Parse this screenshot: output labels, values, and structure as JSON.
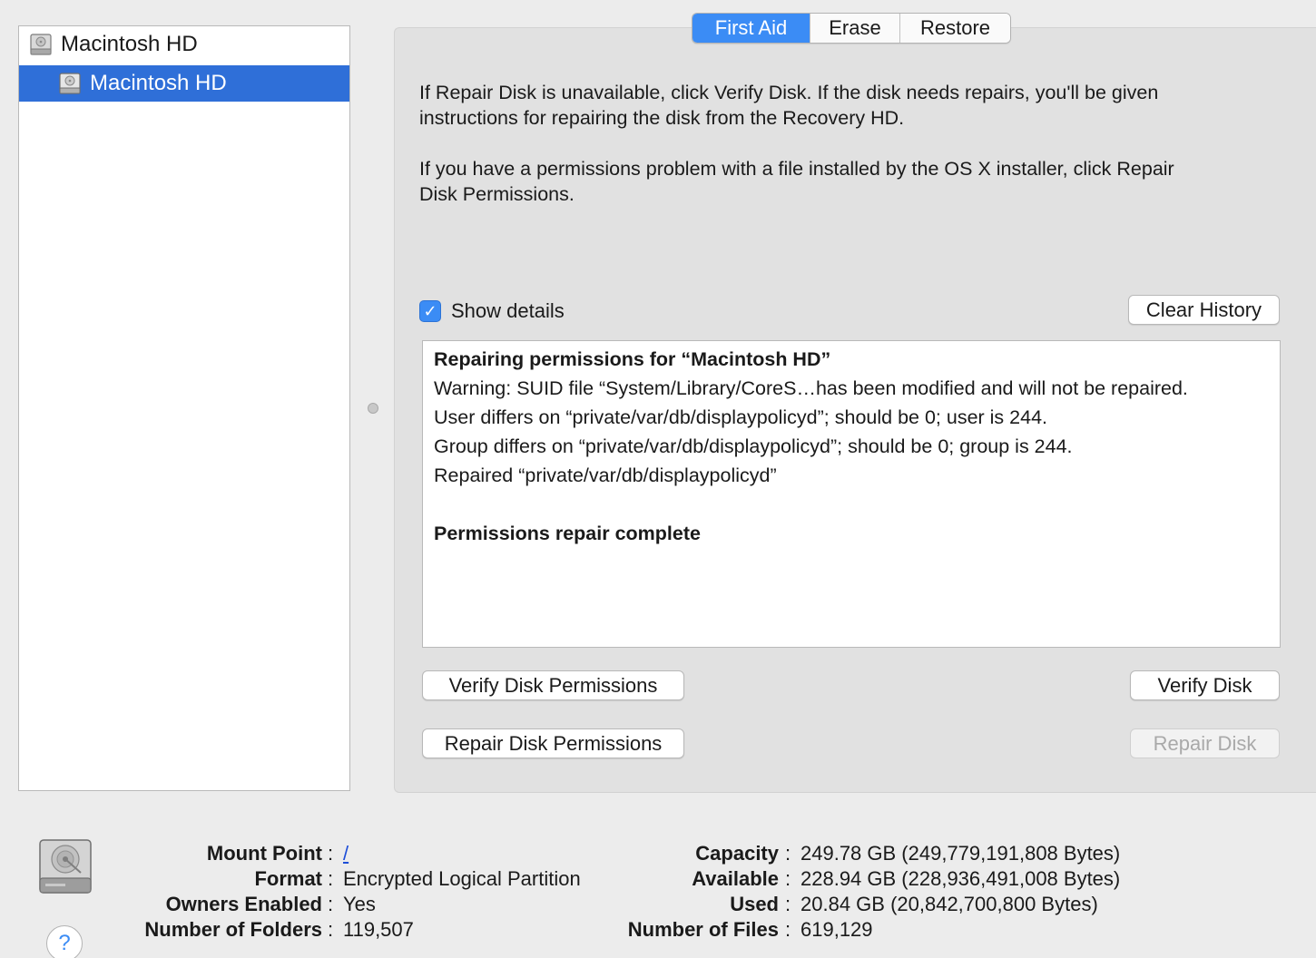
{
  "sidebar": {
    "items": [
      {
        "label": "Macintosh HD"
      },
      {
        "label": "Macintosh HD"
      }
    ]
  },
  "tabs": [
    {
      "label": "First Aid",
      "active": true
    },
    {
      "label": "Erase"
    },
    {
      "label": "Restore"
    }
  ],
  "first_aid": {
    "desc1_line1": "If Repair Disk is unavailable, click Verify Disk. If the disk needs repairs, you'll be given",
    "desc1_line2": "instructions for repairing the disk from the Recovery HD.",
    "desc2_line1": "If you have a permissions problem with a file installed by the OS X installer, click Repair",
    "desc2_line2": "Disk Permissions.",
    "show_details_label": "Show details",
    "show_details_checked": true,
    "clear_history_label": "Clear History",
    "log": [
      "Repairing permissions for “Macintosh HD”",
      "Warning: SUID file “System/Library/CoreS…has been modified and will not be repaired.",
      "User differs on “private/var/db/displaypolicyd”; should be 0; user is 244.",
      "Group differs on “private/var/db/displaypolicyd”; should be 0; group is 244.",
      "Repaired “private/var/db/displaypolicyd”",
      "Permissions repair complete"
    ],
    "verify_permissions_label": "Verify Disk Permissions",
    "repair_permissions_label": "Repair Disk Permissions",
    "verify_disk_label": "Verify Disk",
    "repair_disk_label": "Repair Disk"
  },
  "info": {
    "mount_point_key": "Mount Point",
    "mount_point_val": "/",
    "format_key": "Format",
    "format_val": "Encrypted Logical Partition",
    "owners_key": "Owners Enabled",
    "owners_val": "Yes",
    "folders_key": "Number of Folders",
    "folders_val": "119,507",
    "capacity_key": "Capacity",
    "capacity_val": "249.78 GB (249,779,191,808 Bytes)",
    "available_key": "Available",
    "available_val": "228.94 GB (228,936,491,008 Bytes)",
    "used_key": "Used",
    "used_val": "20.84 GB (20,842,700,800 Bytes)",
    "files_key": "Number of Files",
    "files_val": "619,129",
    "separator": ":"
  },
  "help_label": "?",
  "colors": {
    "accent": "#3b8cf5",
    "selection": "#2f6fd8",
    "window_bg": "#ececec",
    "panel_bg": "#e1e1e1"
  }
}
